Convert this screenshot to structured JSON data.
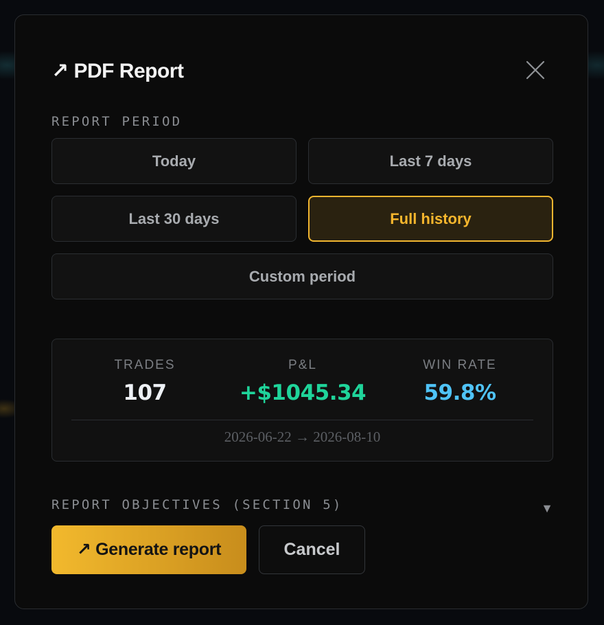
{
  "modal": {
    "title": "↗ PDF Report",
    "close_icon": "close-icon"
  },
  "period": {
    "label": "REPORT PERIOD",
    "options": [
      "Today",
      "Last 7 days",
      "Last 30 days",
      "Full history",
      "Custom period"
    ],
    "selected": "Full history"
  },
  "summary": {
    "trades_label": "TRADES",
    "trades_value": "107",
    "pnl_label": "P&L",
    "pnl_value": "+$1045.34",
    "winrate_label": "WIN RATE",
    "winrate_value": "59.8%",
    "date_range": "2026-06-22 → 2026-08-10"
  },
  "objectives": {
    "label": "REPORT OBJECTIVES (SECTION 5)",
    "chevron": "▼"
  },
  "actions": {
    "generate_label": "↗ Generate report",
    "cancel_label": "Cancel"
  },
  "colors": {
    "accent": "#f1b630",
    "pnl_positive": "#1fd49a",
    "winrate": "#4fc3f7",
    "trades": "#eef1f6"
  }
}
